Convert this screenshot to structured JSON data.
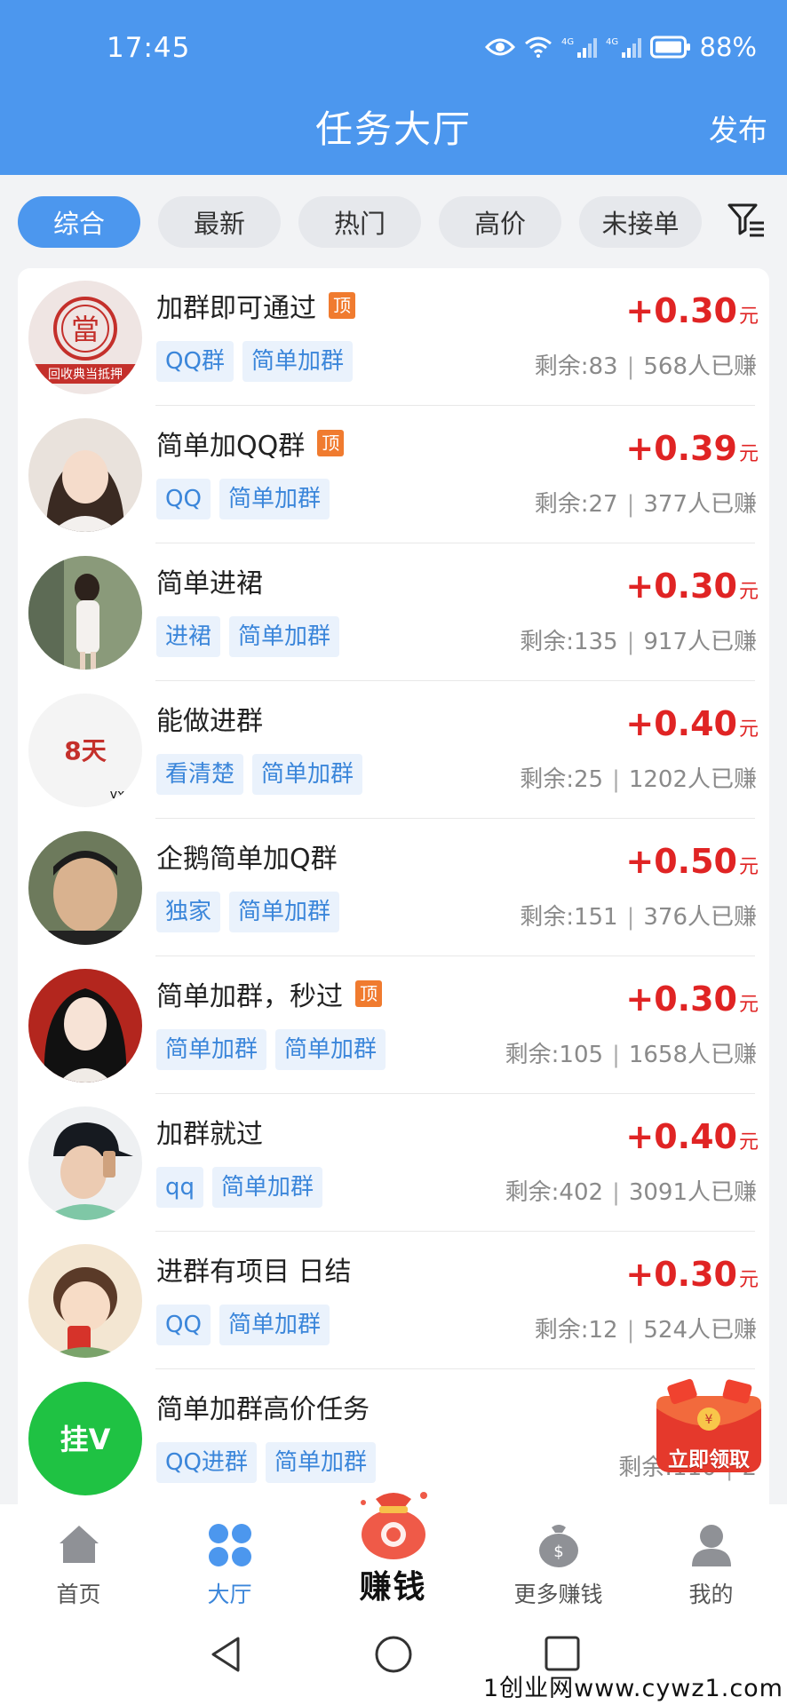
{
  "status_bar": {
    "time": "17:45",
    "signal1": "4G",
    "signal2": "4G",
    "battery": "88%"
  },
  "header": {
    "title": "任务大厅",
    "publish": "发布"
  },
  "filters": [
    {
      "label": "综合",
      "active": true
    },
    {
      "label": "最新",
      "active": false
    },
    {
      "label": "热门",
      "active": false
    },
    {
      "label": "高价",
      "active": false
    },
    {
      "label": "未接单",
      "active": false
    }
  ],
  "tasks": [
    {
      "title": "加群即可通过",
      "top": true,
      "tags": [
        "QQ群",
        "简单加群"
      ],
      "price": "+0.30",
      "unit": "元",
      "remaining": "剩余:83",
      "earned": "568人已赚",
      "avatar_text": "當",
      "avatar_subtext": "回收典当抵押"
    },
    {
      "title": "简单加QQ群",
      "top": true,
      "tags": [
        "QQ",
        "简单加群"
      ],
      "price": "+0.39",
      "unit": "元",
      "remaining": "剩余:27",
      "earned": "377人已赚"
    },
    {
      "title": "简单进裙",
      "top": false,
      "tags": [
        "进裙",
        "简单加群"
      ],
      "price": "+0.30",
      "unit": "元",
      "remaining": "剩余:135",
      "earned": "917人已赚"
    },
    {
      "title": "能做进群",
      "top": false,
      "tags": [
        "看清楚",
        "简单加群"
      ],
      "price": "+0.40",
      "unit": "元",
      "remaining": "剩余:25",
      "earned": "1202人已赚",
      "avatar_text": "8天",
      "avatar_subtext": "vx"
    },
    {
      "title": "企鹅简单加Q群",
      "top": false,
      "tags": [
        "独家",
        "简单加群"
      ],
      "price": "+0.50",
      "unit": "元",
      "remaining": "剩余:151",
      "earned": "376人已赚"
    },
    {
      "title": "简单加群，秒过",
      "top": true,
      "tags": [
        "简单加群",
        "简单加群"
      ],
      "price": "+0.30",
      "unit": "元",
      "remaining": "剩余:105",
      "earned": "1658人已赚"
    },
    {
      "title": "加群就过",
      "top": false,
      "tags": [
        "qq",
        "简单加群"
      ],
      "price": "+0.40",
      "unit": "元",
      "remaining": "剩余:402",
      "earned": "3091人已赚"
    },
    {
      "title": "进群有项目 日结",
      "top": false,
      "tags": [
        "QQ",
        "简单加群"
      ],
      "price": "+0.30",
      "unit": "元",
      "remaining": "剩余:12",
      "earned": "524人已赚"
    },
    {
      "title": "简单加群高价任务",
      "top": false,
      "tags": [
        "QQ进群",
        "简单加群"
      ],
      "price": "+",
      "unit": "",
      "remaining": "剩余:110",
      "earned": "2",
      "avatar_text": "挂V"
    }
  ],
  "top_badge_text": "顶",
  "promo": {
    "label": "立即领取"
  },
  "tabbar": {
    "items": [
      {
        "label": "首页",
        "active": false
      },
      {
        "label": "大厅",
        "active": true
      },
      {
        "label": "赚钱",
        "active": false
      },
      {
        "label": "更多赚钱",
        "active": false
      },
      {
        "label": "我的",
        "active": false
      }
    ]
  },
  "watermark": "1创业网www.cywz1.com",
  "colors": {
    "primary": "#4c97ee",
    "price": "#e02424",
    "tag_bg": "#eaf2fc",
    "tag_text": "#3b86da",
    "top_badge": "#f07b2f"
  }
}
